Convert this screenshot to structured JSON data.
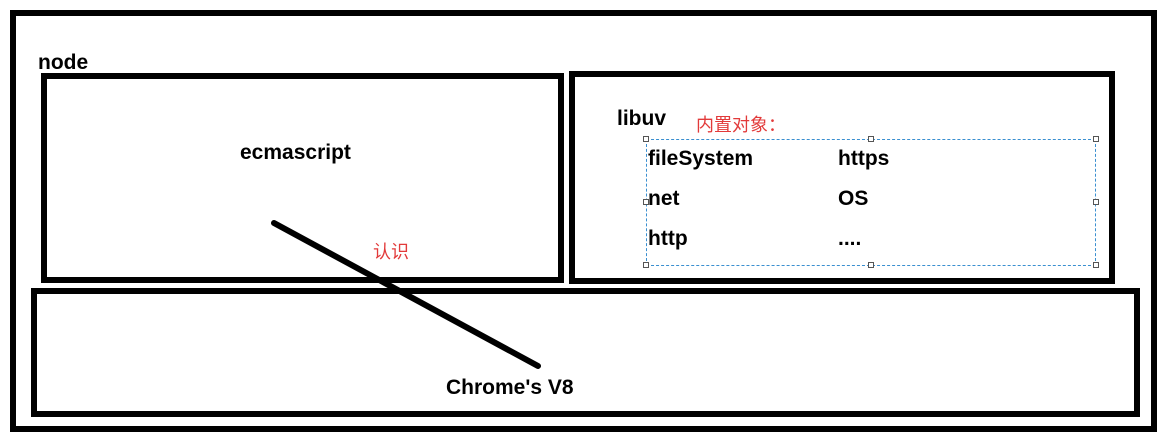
{
  "node": {
    "label": "node"
  },
  "ecmascript": {
    "label": "ecmascript"
  },
  "libuv": {
    "label": "libuv",
    "annotation": "内置对象：",
    "objects": [
      {
        "name": "fileSystem"
      },
      {
        "name": "https"
      },
      {
        "name": "net"
      },
      {
        "name": "OS"
      },
      {
        "name": "http"
      },
      {
        "name": "...."
      }
    ]
  },
  "v8": {
    "label": "Chrome's V8"
  },
  "annotation": {
    "label": "认识"
  },
  "colors": {
    "border": "#000000",
    "annotation": "#e23a3a",
    "selection": "#3a8fd0"
  }
}
